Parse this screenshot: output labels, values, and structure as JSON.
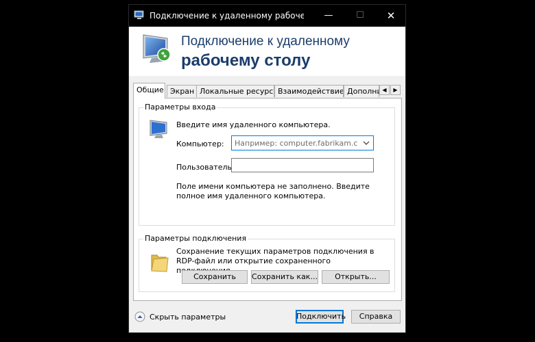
{
  "window": {
    "title": "Подключение к удаленному рабочему сто...",
    "controls": {
      "minimize": "—",
      "maximize": "☐",
      "close": "✕"
    }
  },
  "header": {
    "line1": "Подключение к удаленному",
    "line2": "рабочему столу",
    "icon": "remote-desktop-monitor-icon"
  },
  "tabs": [
    {
      "label": "Общие",
      "active": true
    },
    {
      "label": "Экран",
      "active": false
    },
    {
      "label": "Локальные ресурсы",
      "active": false
    },
    {
      "label": "Взаимодействие",
      "active": false
    },
    {
      "label": "Дополнительно",
      "active": false
    }
  ],
  "tab_scroll": {
    "left": "◀",
    "right": "▶"
  },
  "login_group": {
    "title": "Параметры входа",
    "prompt": "Введите имя удаленного компьютера.",
    "computer_label": "Компьютер:",
    "computer_value": "",
    "computer_placeholder": "Например: computer.fabrikam.com",
    "user_label": "Пользователь:",
    "user_value": "",
    "message": "Поле имени компьютера не заполнено. Введите полное имя удаленного компьютера."
  },
  "connection_group": {
    "title": "Параметры подключения",
    "description": "Сохранение текущих параметров подключения в RDP-файл или открытие сохраненного подключения.",
    "save_button": "Сохранить",
    "save_as_button": "Сохранить как...",
    "open_button": "Открыть..."
  },
  "footer": {
    "hide_params": "Скрыть параметры",
    "connect_button": "Подключить",
    "help_button": "Справка"
  },
  "colors": {
    "title_blue": "#1b3d6b",
    "accent": "#0078d7",
    "titlebar": "#000000"
  }
}
